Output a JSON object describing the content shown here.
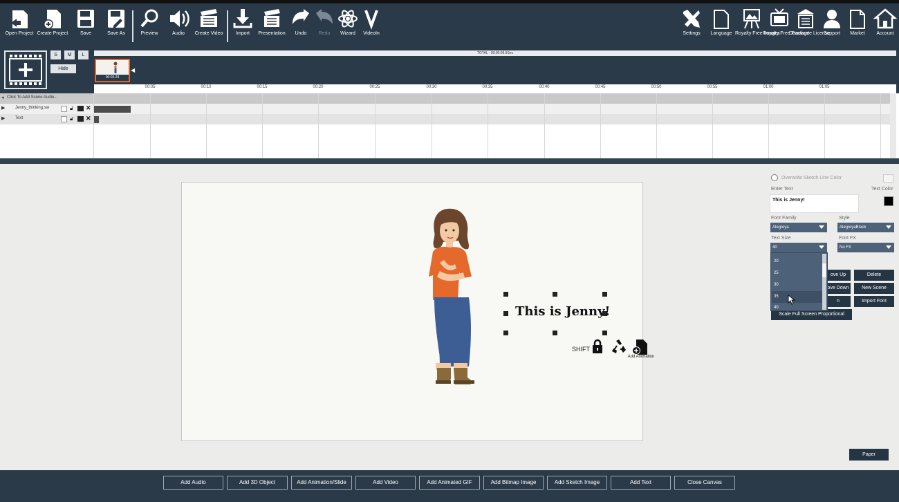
{
  "toolbar": {
    "left": [
      {
        "label": "Open Project",
        "icon": "open-project-icon"
      },
      {
        "label": "Create Project",
        "icon": "create-project-icon"
      },
      {
        "label": "Save",
        "icon": "save-icon"
      },
      {
        "label": "Save As",
        "icon": "save-as-icon"
      },
      {
        "label": "Preview",
        "icon": "preview-icon"
      },
      {
        "label": "Audio",
        "icon": "audio-icon"
      },
      {
        "label": "Create Video",
        "icon": "create-video-icon"
      },
      {
        "label": "Import",
        "icon": "import-icon"
      },
      {
        "label": "Presentation",
        "icon": "presentation-icon"
      },
      {
        "label": "Undo",
        "icon": "undo-icon"
      },
      {
        "label": "Redo",
        "icon": "redo-icon"
      },
      {
        "label": "Wizard",
        "icon": "wizard-icon"
      },
      {
        "label": "VideoIn",
        "icon": "videoin-icon"
      }
    ],
    "right": [
      {
        "label": "Settings",
        "icon": "settings-icon"
      },
      {
        "label": "Language",
        "icon": "language-icon"
      },
      {
        "label": "Royalty Free Images",
        "icon": "royalty-free-images-icon"
      },
      {
        "label": "Royalty Free Footage",
        "icon": "royalty-free-footage-icon"
      },
      {
        "label": "Deactivate License",
        "icon": "deactivate-license-icon"
      },
      {
        "label": "Support",
        "icon": "support-icon"
      },
      {
        "label": "Market",
        "icon": "market-icon"
      },
      {
        "label": "Account",
        "icon": "account-icon"
      }
    ]
  },
  "timeline": {
    "size_buttons": [
      "S",
      "M",
      "L"
    ],
    "hide_label": "Hide",
    "total_label": "TOTAL - 00:00:09.9Sec",
    "scene_time": "00:03.29",
    "ruler_ticks": [
      "00:05",
      "00:10",
      "00:15",
      "00:20",
      "00:25",
      "00:30",
      "00:35",
      "00:40",
      "00:45",
      "00:50",
      "00:55",
      "01:00",
      "01:05"
    ],
    "tracks": [
      {
        "name": "Click To Add Scene Audio..."
      },
      {
        "name": "Jenny_thinking.sw"
      },
      {
        "name": "Text"
      }
    ]
  },
  "canvas": {
    "text": "This is Jenny!",
    "shift_label": "SHIFT",
    "add_animation_label": "Add Animation"
  },
  "panel": {
    "overwrite_label": "Overwrite Sketch Line Color",
    "enter_text_label": "Enter Text",
    "text_color_label": "Text Color",
    "text_color": "#000000",
    "text_value": "This is Jenny!",
    "font_family_label": "Font Family",
    "font_family_value": "Alegreya",
    "style_label": "Style",
    "style_value": "AlegreyaBlack",
    "text_size_label": "Text Size",
    "text_size_value": "40",
    "font_fx_label": "Font FX",
    "font_fx_value": "No FX",
    "size_options": [
      "20",
      "25",
      "30",
      "35",
      "40"
    ],
    "buttons": {
      "move_up": "ove Up",
      "delete": "Delete",
      "move_down": "ove Down",
      "new_scene": "New Scene",
      "hidden": "n",
      "import_font": "Import Font",
      "scale_full": "Scale Full Screen Proportional",
      "paper": "Paper"
    }
  },
  "bottombar": [
    "Add Audio",
    "Add 3D Object",
    "Add Animation/Slide",
    "Add Video",
    "Add Animated GIF",
    "Add Bitmap Image",
    "Add Sketch Image",
    "Add Text",
    "Close Canvas"
  ],
  "colors": {
    "toolbar_bg": "#2b3a49",
    "accent": "#e2672b",
    "panel_select": "#4d6278"
  }
}
